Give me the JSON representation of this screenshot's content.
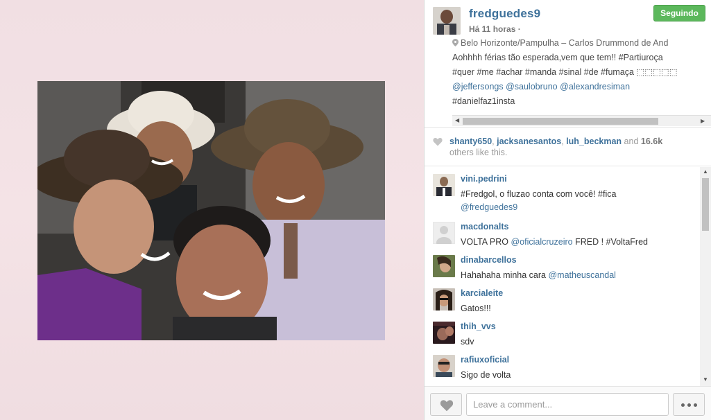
{
  "post": {
    "username": "fredguedes9",
    "follow_label": "Seguindo",
    "time": "Há 11 horas ·",
    "location": "Belo Horizonte/Pampulha – Carlos Drummond de And",
    "caption_lines": [
      "Aohhhh férias tão esperada,vem que tem!! #Partiuroça",
      "#quer #me #achar #manda #sinal #de #fumaça ⬚⬚⬚⬚⬚",
      "",
      "#danielfaz1insta"
    ],
    "caption_mentions": [
      "@jeffersongs",
      "@saulobruno",
      "@alexandresiman"
    ]
  },
  "likes": {
    "users": [
      "shanty650",
      "jacksanesantos",
      "luh_beckman"
    ],
    "sep1": ", ",
    "sep2": ", ",
    "and_text": " and ",
    "count": "16.6k",
    "suffix": "others like this."
  },
  "comments": [
    {
      "user": "vini.pedrini",
      "text": "#Fredgol, o fluzao conta com você! #fica",
      "mention": "@fredguedes9"
    },
    {
      "user": "macdonalts",
      "text_before": "VOLTA PRO ",
      "mention": "@oficialcruzeiro",
      "text_after": " FRED ! #VoltaFred"
    },
    {
      "user": "dinabarcellos",
      "text_before": "Hahahaha minha cara ",
      "mention": "@matheuscandal"
    },
    {
      "user": "karcialeite",
      "text": "Gatos!!!"
    },
    {
      "user": "thih_vvs",
      "text": "sdv"
    },
    {
      "user": "rafiuxoficial",
      "text": "Sigo de volta"
    }
  ],
  "footer": {
    "comment_placeholder": "Leave a comment..."
  },
  "colors": {
    "link": "#3f729b",
    "follow_green": "#5cb85c",
    "backdrop_pink": "#f1dfe3"
  }
}
